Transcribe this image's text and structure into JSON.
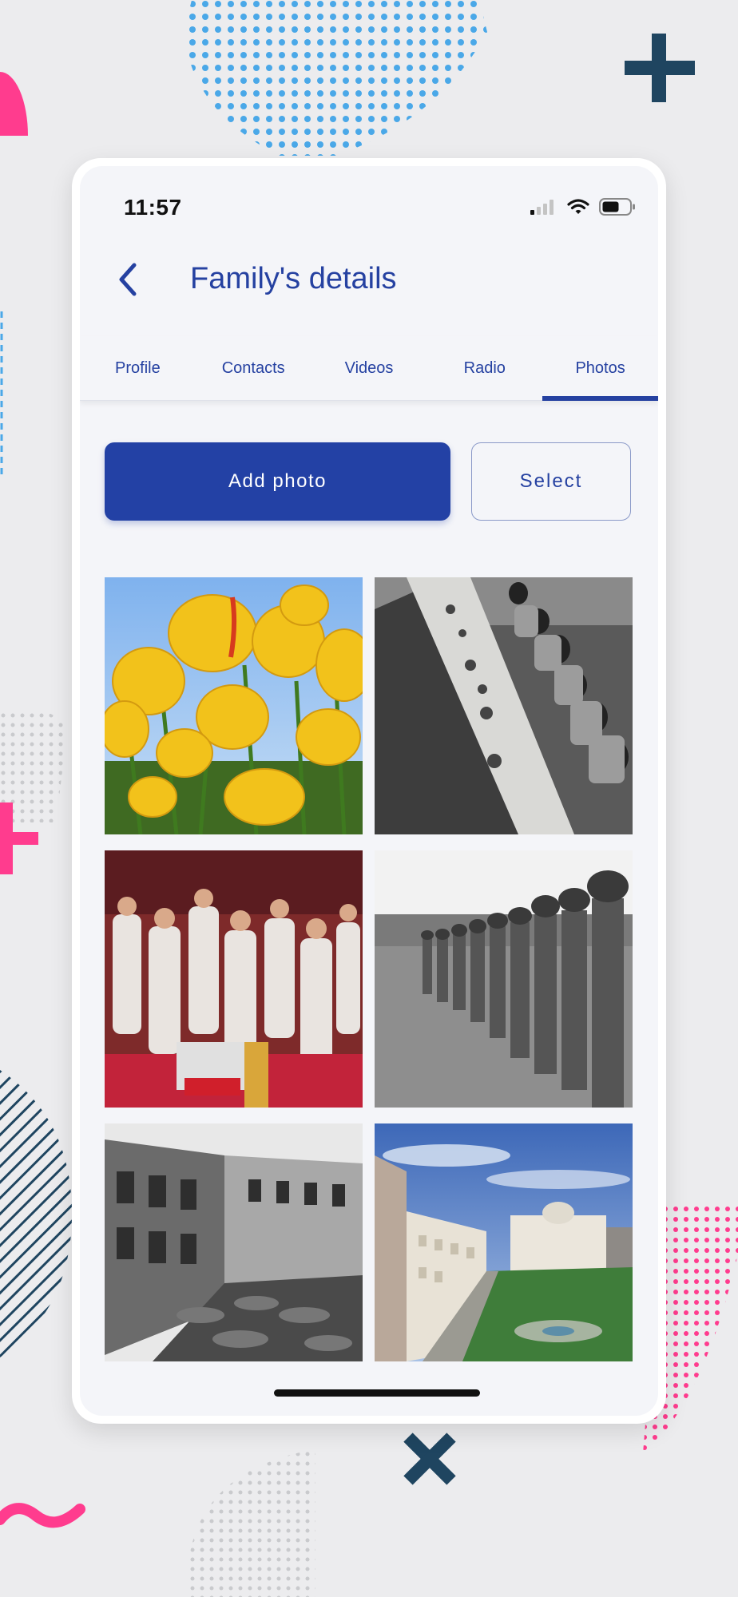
{
  "status_bar": {
    "time": "11:57"
  },
  "header": {
    "title": "Family's details"
  },
  "tabs": [
    {
      "label": "Profile"
    },
    {
      "label": "Contacts"
    },
    {
      "label": "Videos"
    },
    {
      "label": "Radio"
    },
    {
      "label": "Photos",
      "active": true
    }
  ],
  "actions": {
    "add_photo": "Add photo",
    "select": "Select"
  },
  "photos": [
    {
      "subject": "yellow tulips"
    },
    {
      "subject": "women at a long banquet table"
    },
    {
      "subject": "crowd in white at a parade"
    },
    {
      "subject": "soldiers standing in line"
    },
    {
      "subject": "old street market with shophouses"
    },
    {
      "subject": "colonial buildings and city square"
    }
  ],
  "colors": {
    "accent": "#2341a5",
    "background": "#f4f5f9",
    "deco_pink": "#ff3c8e",
    "deco_blue": "#4aa8e8",
    "deco_navy": "#1f4560"
  }
}
